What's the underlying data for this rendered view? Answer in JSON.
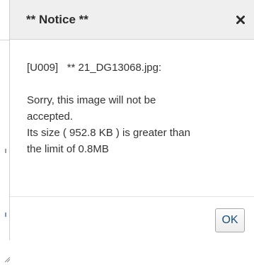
{
  "dialog": {
    "title": "** Notice **",
    "close_icon": "close-icon",
    "file_code": "[U009]",
    "file_name": "** 21_DG13068.jpg:",
    "message_lines": [
      "Sorry, this image will not be",
      "accepted.",
      "Its size ( 952.8 KB ) is greater than",
      "the limit of 0.8MB"
    ],
    "ok_label": "OK"
  },
  "colors": {
    "header_bg": "#efefef",
    "ok_text": "#1c4f7c",
    "body_text": "#333333"
  }
}
